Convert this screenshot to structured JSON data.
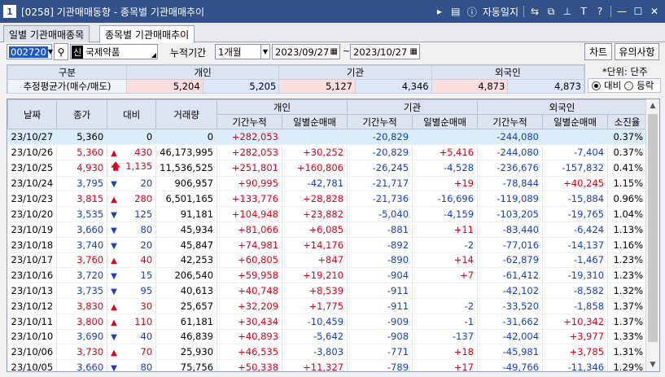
{
  "window": {
    "number": "1",
    "title": "[0258] 기관매매동향 - 종목별 기관매매추이",
    "autolog_label": "자동일지",
    "icons": [
      "arrow-right-icon",
      "menu-icon",
      "info-icon",
      "link-icon",
      "restore-icon",
      "pin-icon",
      "text-icon",
      "help-icon",
      "minimize-icon",
      "maximize-icon",
      "close-icon"
    ]
  },
  "tabs": [
    {
      "label": "일별 기관매매종목"
    },
    {
      "label": "종목별 기관매매추이"
    }
  ],
  "controls": {
    "code": "002720",
    "market_tag": "신",
    "stock_name": "국제약품",
    "period_label": "누적기간",
    "period_value": "1개월",
    "date_from": "2023/09/27",
    "date_to": "2023/10/27",
    "tilde": "~",
    "chart_button": "차트",
    "notice_button": "유의사항"
  },
  "summary": {
    "col_label": "구분",
    "groups": [
      "개인",
      "기관",
      "외국인"
    ],
    "row_label": "추정평균가(매수/매도)",
    "values": [
      "5,204",
      "5,205",
      "5,127",
      "4,346",
      "4,873",
      "4,873"
    ],
    "unit_text": "*단위: 단주",
    "radio_options": [
      "대비",
      "등락"
    ],
    "radio_selected": "대비"
  },
  "grid": {
    "headers": {
      "date": "날짜",
      "close": "종가",
      "diff": "대비",
      "volume": "거래량",
      "groups": [
        "개인",
        "기관",
        "외국인"
      ],
      "sub": [
        "기간누적",
        "일별순매매",
        "기간누적",
        "일별순매매",
        "기간누적",
        "일별순매매",
        "소진율"
      ]
    },
    "rows": [
      {
        "d": "23/10/27",
        "close": "5,360",
        "arrow": "",
        "diff": "0",
        "vol": "0",
        "p1": "+282,053",
        "p2": "",
        "i1": "-20,829",
        "i2": "",
        "f1": "-244,080",
        "f2": "",
        "rate": "0.37%"
      },
      {
        "d": "23/10/26",
        "close": "5,360",
        "arrow": "up",
        "diff": "430",
        "vol": "46,173,995",
        "p1": "+282,053",
        "p2": "+30,252",
        "i1": "-20,829",
        "i2": "+5,416",
        "f1": "-244,080",
        "f2": "-7,404",
        "rate": "0.37%"
      },
      {
        "d": "23/10/25",
        "close": "4,930",
        "arrow": "bigup",
        "diff": "1,135",
        "vol": "11,536,525",
        "p1": "+251,801",
        "p2": "+160,806",
        "i1": "-26,245",
        "i2": "-4,528",
        "f1": "-236,676",
        "f2": "-157,832",
        "rate": "0.41%"
      },
      {
        "d": "23/10/24",
        "close": "3,795",
        "arrow": "down",
        "diff": "20",
        "vol": "906,957",
        "p1": "+90,995",
        "p2": "-42,781",
        "i1": "-21,717",
        "i2": "+19",
        "f1": "-78,844",
        "f2": "+40,245",
        "rate": "1.15%"
      },
      {
        "d": "23/10/23",
        "close": "3,815",
        "arrow": "up",
        "diff": "280",
        "vol": "6,501,165",
        "p1": "+133,776",
        "p2": "+28,828",
        "i1": "-21,736",
        "i2": "-16,696",
        "f1": "-119,089",
        "f2": "-15,884",
        "rate": "0.96%"
      },
      {
        "d": "23/10/20",
        "close": "3,535",
        "arrow": "down",
        "diff": "125",
        "vol": "91,181",
        "p1": "+104,948",
        "p2": "+23,882",
        "i1": "-5,040",
        "i2": "-4,159",
        "f1": "-103,205",
        "f2": "-19,765",
        "rate": "1.04%"
      },
      {
        "d": "23/10/19",
        "close": "3,660",
        "arrow": "down",
        "diff": "80",
        "vol": "45,934",
        "p1": "+81,066",
        "p2": "+6,085",
        "i1": "-881",
        "i2": "+11",
        "f1": "-83,440",
        "f2": "-6,424",
        "rate": "1.13%"
      },
      {
        "d": "23/10/18",
        "close": "3,740",
        "arrow": "down",
        "diff": "20",
        "vol": "45,847",
        "p1": "+74,981",
        "p2": "+14,176",
        "i1": "-892",
        "i2": "-2",
        "f1": "-77,016",
        "f2": "-14,137",
        "rate": "1.16%"
      },
      {
        "d": "23/10/17",
        "close": "3,760",
        "arrow": "up",
        "diff": "40",
        "vol": "42,253",
        "p1": "+60,805",
        "p2": "+847",
        "i1": "-890",
        "i2": "+14",
        "f1": "-62,879",
        "f2": "-1,467",
        "rate": "1.23%"
      },
      {
        "d": "23/10/16",
        "close": "3,720",
        "arrow": "down",
        "diff": "15",
        "vol": "206,540",
        "p1": "+59,958",
        "p2": "+19,210",
        "i1": "-904",
        "i2": "+7",
        "f1": "-61,412",
        "f2": "-19,310",
        "rate": "1.23%"
      },
      {
        "d": "23/10/13",
        "close": "3,735",
        "arrow": "down",
        "diff": "95",
        "vol": "40,613",
        "p1": "+40,748",
        "p2": "+8,539",
        "i1": "-911",
        "i2": "",
        "f1": "-42,102",
        "f2": "-8,582",
        "rate": "1.32%"
      },
      {
        "d": "23/10/12",
        "close": "3,830",
        "arrow": "up",
        "diff": "30",
        "vol": "25,657",
        "p1": "+32,209",
        "p2": "+1,775",
        "i1": "-911",
        "i2": "-2",
        "f1": "-33,520",
        "f2": "-1,858",
        "rate": "1.37%"
      },
      {
        "d": "23/10/11",
        "close": "3,800",
        "arrow": "up",
        "diff": "110",
        "vol": "61,181",
        "p1": "+30,434",
        "p2": "-10,459",
        "i1": "-909",
        "i2": "-1",
        "f1": "-31,662",
        "f2": "+10,342",
        "rate": "1.37%"
      },
      {
        "d": "23/10/10",
        "close": "3,690",
        "arrow": "down",
        "diff": "40",
        "vol": "46,839",
        "p1": "+40,893",
        "p2": "-5,642",
        "i1": "-908",
        "i2": "-137",
        "f1": "-42,004",
        "f2": "+3,977",
        "rate": "1.33%"
      },
      {
        "d": "23/10/06",
        "close": "3,730",
        "arrow": "up",
        "diff": "70",
        "vol": "25,930",
        "p1": "+46,535",
        "p2": "-3,803",
        "i1": "-771",
        "i2": "+18",
        "f1": "-45,981",
        "f2": "+3,785",
        "rate": "1.31%"
      },
      {
        "d": "23/10/05",
        "close": "3,660",
        "arrow": "down",
        "diff": "80",
        "vol": "75,756",
        "p1": "+50,338",
        "p2": "+11,327",
        "i1": "-789",
        "i2": "+17",
        "f1": "-49,766",
        "f2": "-11,346",
        "rate": "1.29%"
      }
    ]
  },
  "colors": {
    "titlebar": "#34508a",
    "positive": "#e0001a",
    "negative": "#1a3cc8",
    "header_bg": "#dde4ef",
    "highlight_row": "#d9ecf8"
  }
}
